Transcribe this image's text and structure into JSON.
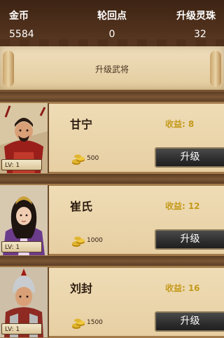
{
  "stats": {
    "gold": {
      "label": "金币",
      "value": "5584"
    },
    "return_points": {
      "label": "轮回点",
      "value": "0"
    },
    "upgrade_orbs": {
      "label": "升级灵珠",
      "value": "32"
    }
  },
  "banner": {
    "title": "升级武将"
  },
  "heroes": [
    {
      "name": "甘宁",
      "level": "LV: 1",
      "income_label": "收益:",
      "income": "8",
      "cost": "500",
      "button": "升级",
      "portrait_icon": "warrior-red-armor"
    },
    {
      "name": "崔氏",
      "level": "LV: 1",
      "income_label": "收益:",
      "income": "12",
      "cost": "1000",
      "button": "升级",
      "portrait_icon": "lady-purple-robe"
    },
    {
      "name": "刘封",
      "level": "LV: 1",
      "income_label": "收益:",
      "income": "16",
      "cost": "1500",
      "button": "升级",
      "portrait_icon": "warrior-silver-helmet"
    }
  ],
  "colors": {
    "income": "#c49a1c",
    "button_bg": "#2e2e2e",
    "panel": "#efdcb5"
  }
}
